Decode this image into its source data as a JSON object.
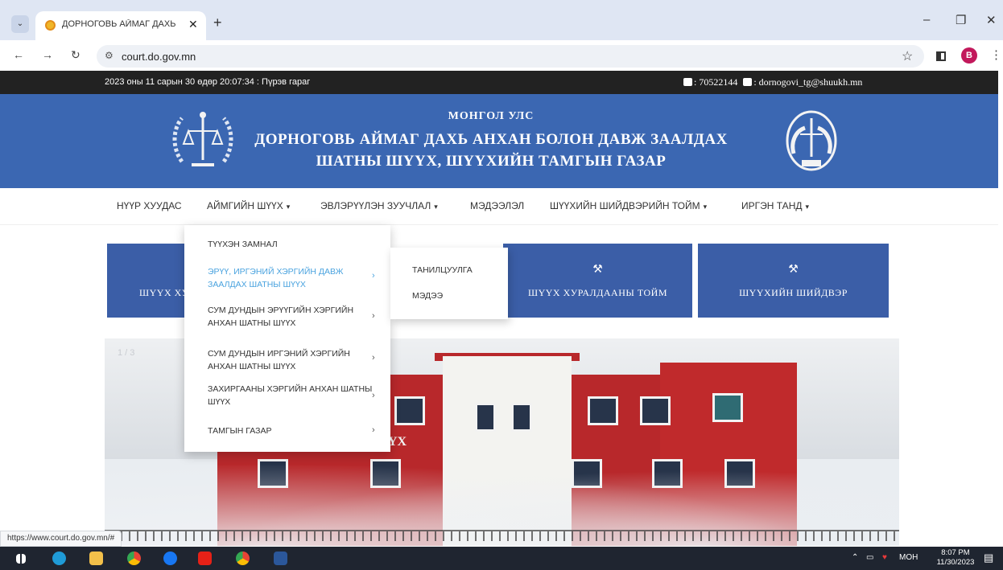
{
  "browser": {
    "tab_title": "ДОРНОГОВЬ АЙМАГ ДАХЬ Ш…",
    "url": "court.do.gov.mn",
    "profile_initial": "B",
    "status_url": "https://www.court.do.gov.mn/#"
  },
  "topbar": {
    "datetime": "2023 оны 11 сарын 30 өдөр 20:07:34 : Пүрэв гараг",
    "phone": ": 70522144",
    "email": ": dornogovi_tg@shuukh.mn"
  },
  "banner": {
    "line1": "МОНГОЛ УЛС",
    "line2": "ДОРНОГОВЬ АЙМАГ ДАХЬ АНХАН БОЛОН ДАВЖ ЗААЛДАХ",
    "line3": "ШАТНЫ ШҮҮХ, ШҮҮХИЙН ТАМГЫН ГАЗАР",
    "color": "#3b67b2"
  },
  "nav": {
    "home": "НҮҮР ХУУДАС",
    "court": "АЙМГИЙН ШҮҮХ",
    "guidance": "ЭВЛЭРҮҮЛЭН ЗУУЧЛАЛ",
    "info": "МЭДЭЭЛЭЛ",
    "decision_review": "ШҮҮХИЙН ШИЙДВЭРИЙН ТОЙМ",
    "citizen": "ИРГЭН ТАНД"
  },
  "dropdown": {
    "items": [
      "ТҮҮХЭН ЗАМНАЛ",
      "ЭРҮҮ, ИРГЭНИЙ ХЭРГИЙН ДАВЖ ЗААЛДАХ ШАТНЫ ШҮҮХ",
      "СУМ ДУНДЫН ЭРҮҮГИЙН ХЭРГИЙН АНХАН ШАТНЫ ШҮҮХ",
      "СУМ ДУНДЫН ИРГЭНИЙ ХЭРГИЙН АНХАН ШАТНЫ ШҮҮХ",
      "ЗАХИРГААНЫ ХЭРГИЙН АНХАН ШАТНЫ ШҮҮХ",
      "ТАМГЫН ГАЗАР"
    ],
    "submenu": [
      "ТАНИЛЦУУЛГА",
      "МЭДЭЭ"
    ]
  },
  "tiles": {
    "tile1": "ШҮҮХ ХУ",
    "tile2": "ШҮҮХ ХУРАЛДААНЫ ТОЙМ",
    "tile3": "ШҮҮХИЙН ШИЙДВЭР"
  },
  "slider": {
    "counter": "1 / 3",
    "sign_text": "ҮХ"
  },
  "taskbar": {
    "lang": "МОН",
    "time": "8:07 PM",
    "date": "11/30/2023"
  }
}
